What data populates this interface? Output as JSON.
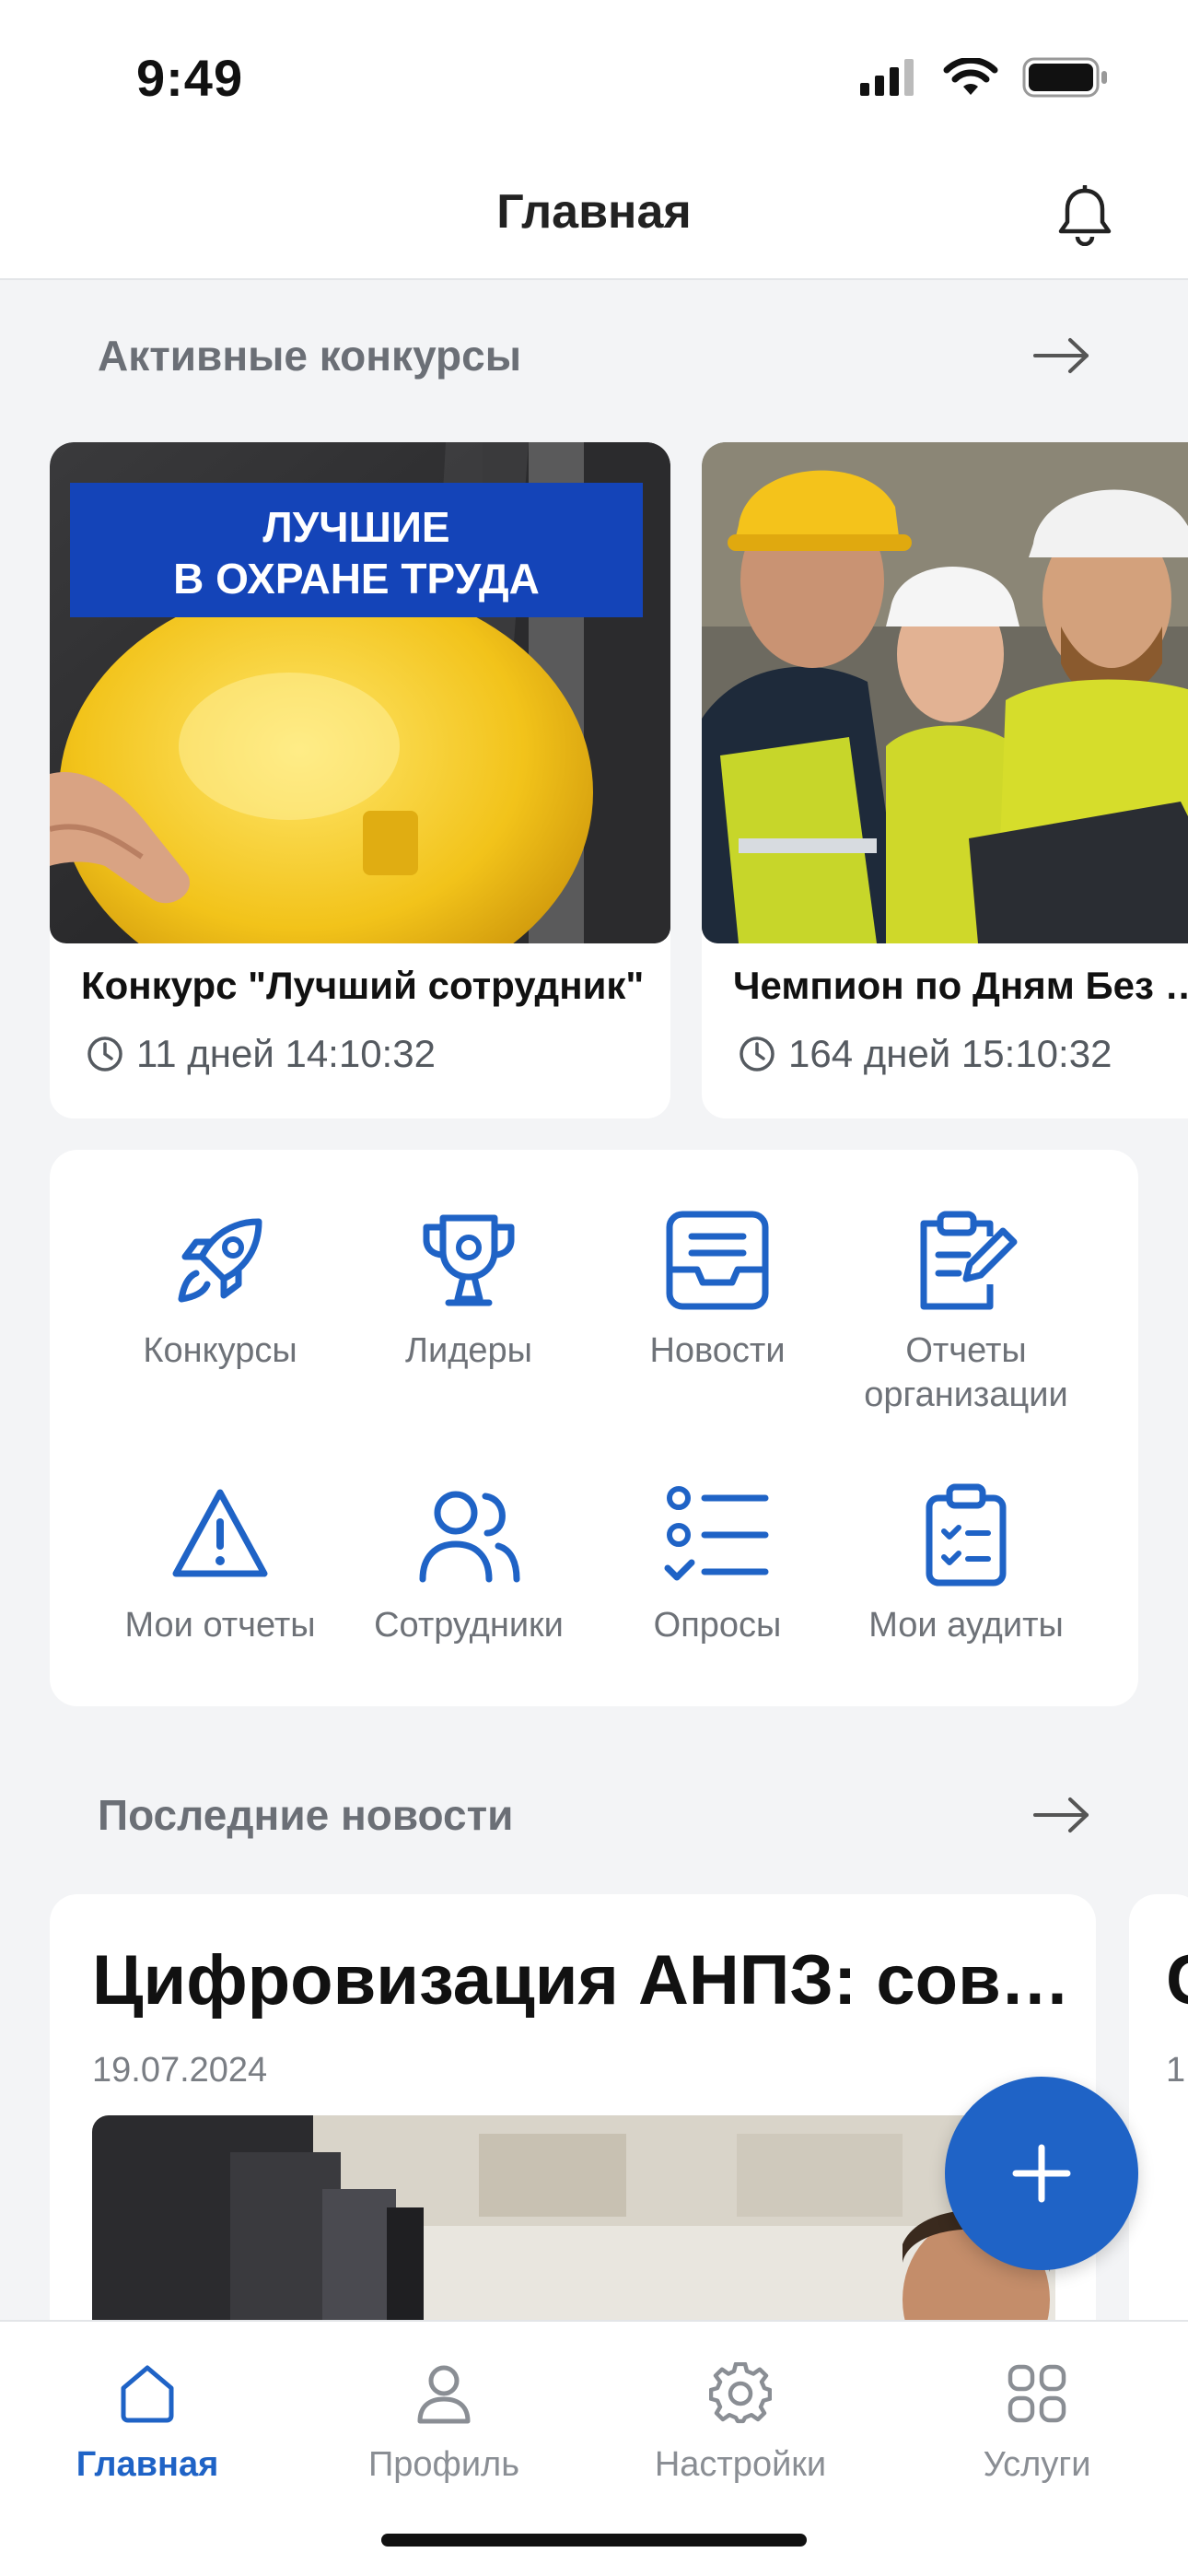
{
  "status_bar": {
    "time": "9:49"
  },
  "header": {
    "title": "Главная"
  },
  "active_contests": {
    "title": "Активные конкурсы",
    "cards": [
      {
        "image_text_line1": "ЛУЧШИЕ",
        "image_text_line2": "В ОХРАНЕ ТРУДА",
        "title": "Конкурс \"Лучший сотрудник\"",
        "timer": "11 дней 14:10:32"
      },
      {
        "title": "Чемпион по Дням Без Травм",
        "timer": "164 дней 15:10:32"
      }
    ]
  },
  "quick_actions": [
    {
      "label": "Конкурсы",
      "icon": "rocket-icon"
    },
    {
      "label": "Лидеры",
      "icon": "trophy-icon"
    },
    {
      "label": "Новости",
      "icon": "inbox-news-icon"
    },
    {
      "label": "Отчеты организации",
      "icon": "clipboard-edit-icon"
    },
    {
      "label": "Мои отчеты",
      "icon": "warning-icon"
    },
    {
      "label": "Сотрудники",
      "icon": "users-icon"
    },
    {
      "label": "Опросы",
      "icon": "checklist-icon"
    },
    {
      "label": "Мои аудиты",
      "icon": "clipboard-check-icon"
    }
  ],
  "latest_news": {
    "title": "Последние новости",
    "cards": [
      {
        "title": "Цифровизация АНПЗ: совместная работа",
        "date": "19.07.2024"
      },
      {
        "title": "С",
        "date": "1"
      }
    ]
  },
  "tabbar": [
    {
      "label": "Главная",
      "icon": "home-icon",
      "active": true
    },
    {
      "label": "Профиль",
      "icon": "profile-icon",
      "active": false
    },
    {
      "label": "Настройки",
      "icon": "gear-icon",
      "active": false
    },
    {
      "label": "Услуги",
      "icon": "grid-icon",
      "active": false
    }
  ],
  "colors": {
    "accent": "#1f63c6",
    "background": "#f3f4f6",
    "banner_blue": "#1444b8",
    "helmet_yellow": "#f2c31a"
  }
}
